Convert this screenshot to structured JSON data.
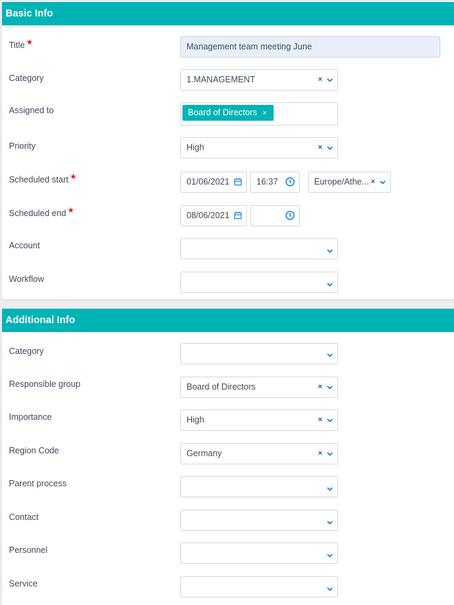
{
  "basic_info": {
    "header": "Basic Info",
    "title": {
      "label": "Title",
      "required": true,
      "value": "Management team meeting June"
    },
    "category": {
      "label": "Category",
      "value": "1.MANAGEMENT"
    },
    "assigned_to": {
      "label": "Assigned to",
      "chips": [
        "Board of Directors"
      ]
    },
    "priority": {
      "label": "Priority",
      "value": "High"
    },
    "scheduled_start": {
      "label": "Scheduled start",
      "required": true,
      "date": "01/06/2021",
      "time": "16:37",
      "timezone": "Europe/Athe..."
    },
    "scheduled_end": {
      "label": "Scheduled end",
      "required": true,
      "date": "08/06/2021",
      "time": ""
    },
    "account": {
      "label": "Account",
      "value": ""
    },
    "workflow": {
      "label": "Workflow",
      "value": ""
    }
  },
  "additional_info": {
    "header": "Additional Info",
    "category": {
      "label": "Category",
      "value": ""
    },
    "responsible_group": {
      "label": "Responsible group",
      "value": "Board of Directors"
    },
    "importance": {
      "label": "Importance",
      "value": "High"
    },
    "region_code": {
      "label": "Region Code",
      "value": "Germany"
    },
    "parent_process": {
      "label": "Parent process",
      "value": ""
    },
    "contact": {
      "label": "Contact",
      "value": ""
    },
    "personnel": {
      "label": "Personnel",
      "value": ""
    },
    "service": {
      "label": "Service",
      "value": ""
    }
  },
  "icons": {
    "required": "★",
    "clear": "×"
  },
  "colors": {
    "header": "#00b3b5",
    "accent_icon": "#1a7fd6",
    "required": "#ee1111"
  }
}
